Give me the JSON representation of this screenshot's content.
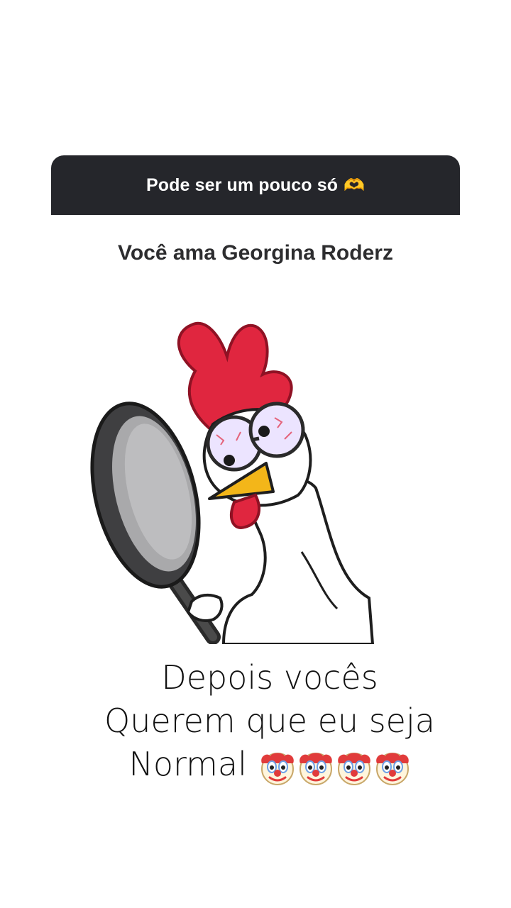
{
  "question_card": {
    "text": "Pode ser um pouco só",
    "emoji": "🫶",
    "emoji_icon": "heart-hands-icon",
    "background": "#25262b"
  },
  "answer": {
    "text": "Você ama Georgina Roderz"
  },
  "sticker": {
    "icon": "cartoon-rooster-with-frying-pan"
  },
  "caption": {
    "line1": "Depois vocês",
    "line2": "Querem que eu seja",
    "line3": "Normal",
    "emoji_icon": "clown-face-icon",
    "emoji_count": 4
  }
}
